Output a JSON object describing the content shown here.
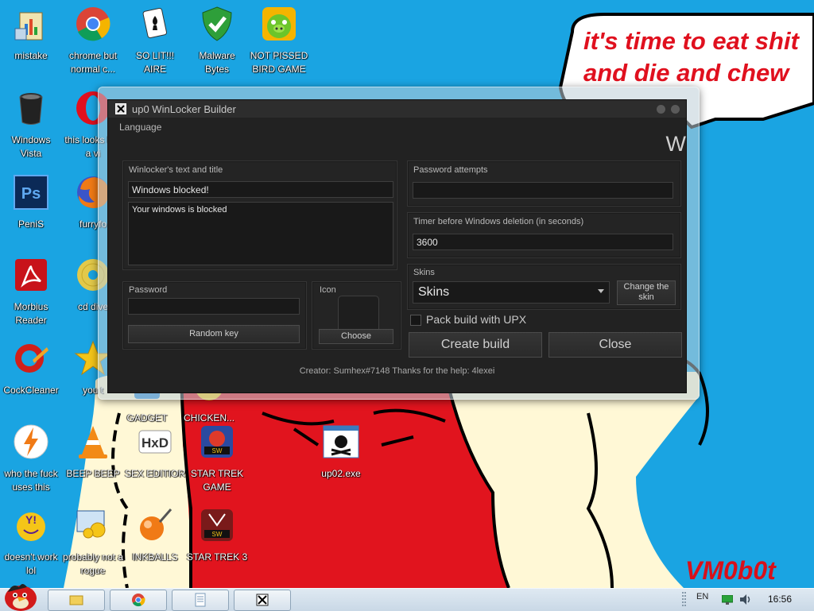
{
  "wallpaper": {
    "speech_text": "it's time to eat shit\nand die and chew\n        um",
    "signature": "VM0b0t",
    "colors": {
      "sky": "#1aa4e2",
      "shirt": "#e1141e",
      "skin": "#fff8d6"
    }
  },
  "desktop_icons": [
    {
      "label": "mistake",
      "icon": "clipboard-chart-icon"
    },
    {
      "label": "chrome but normal c...",
      "icon": "chrome-icon"
    },
    {
      "label": "SO LIT!!! AIRE",
      "icon": "solitaire-icon"
    },
    {
      "label": "Malware Bytes",
      "icon": "shield-check-icon"
    },
    {
      "label": "NOT PISSED BIRD GAME",
      "icon": "green-pig-icon"
    },
    {
      "label": "Windows Vista",
      "icon": "trash-bin-icon"
    },
    {
      "label": "this looks like a vi",
      "icon": "opera-icon"
    },
    {
      "label": "PeniS",
      "icon": "photoshop-icon"
    },
    {
      "label": "furryfo",
      "icon": "firefox-icon"
    },
    {
      "label": "Morbius Reader",
      "icon": "pdf-reader-icon"
    },
    {
      "label": "cd dive",
      "icon": "cd-drive-icon"
    },
    {
      "label": "CockCleaner",
      "icon": "ccleaner-icon"
    },
    {
      "label": "you t",
      "icon": "star-icon"
    },
    {
      "label": "who the fuck uses this",
      "icon": "avast-icon"
    },
    {
      "label": "BEEP BEEP",
      "icon": "vlc-cone-icon"
    },
    {
      "label": "SEX EDITIOR",
      "icon": "hxd-icon"
    },
    {
      "label": "STAR TREK GAME",
      "icon": "star-wars-game-icon"
    },
    {
      "label": "up02.exe",
      "icon": "skull-exe-icon"
    },
    {
      "label": "doesn't work lol",
      "icon": "yahoo-messenger-icon"
    },
    {
      "label": "probably not a rogue",
      "icon": "gears-monitor-icon"
    },
    {
      "label": "INKBALLS",
      "icon": "inkball-icon"
    },
    {
      "label": "STAR TREK 3",
      "icon": "star-wars-3-icon"
    },
    {
      "label": "GADGET",
      "icon": "gadget-icon"
    },
    {
      "label": "CHICKEN...",
      "icon": "chicken-icon"
    }
  ],
  "window": {
    "title": "up0 WinLocker Builder",
    "language_label": "Language",
    "corner_letter": "W",
    "winlocker_group_label": "Winlocker's text and title",
    "title_value": "Windows blocked!",
    "text_value": "Your windows is blocked",
    "password_group_label": "Password",
    "password_value": "",
    "random_key_label": "Random key",
    "icon_group_label": "Icon",
    "choose_label": "Choose",
    "password_attempts_label": "Password attempts",
    "password_attempts_value": "",
    "timer_label": "Timer before Windows deletion (in seconds)",
    "timer_value": "3600",
    "skins_group_label": "Skins",
    "skins_selected": "Skins",
    "change_skin_label": "Change the skin",
    "pack_upx_label": "Pack build with UPX",
    "pack_upx_checked": false,
    "create_build_label": "Create build",
    "close_label": "Close",
    "footer_text": "Creator: Sumhex#7148 Thanks for the help: 4lexei"
  },
  "taskbar": {
    "language": "EN",
    "clock": "16:56",
    "pinned": [
      "explorer-icon",
      "chrome-icon",
      "notepad-icon",
      "winlocker-icon"
    ]
  }
}
